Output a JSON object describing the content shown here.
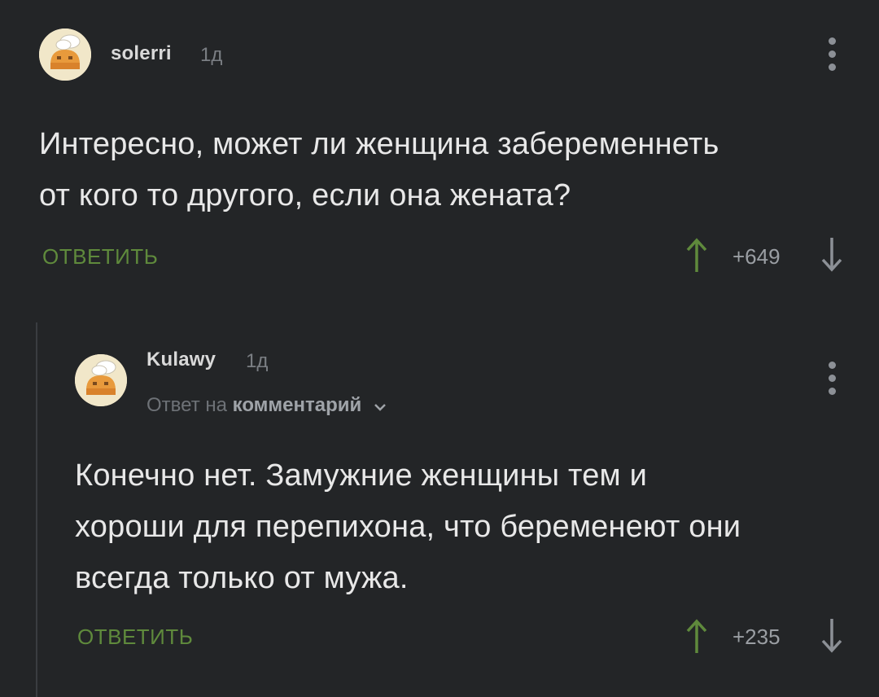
{
  "comments": [
    {
      "author": "solerri",
      "time": "1д",
      "text_lines": [
        "Интересно, может ли женщина забеременнеть",
        "от кого то другого, если она жената?"
      ],
      "reply_label": "ОТВЕТИТЬ",
      "score": "+649",
      "avatar_icon": "avatar-cook-icon"
    },
    {
      "author": "Kulawy",
      "time": "1д",
      "reply_to_prefix": "Ответ на",
      "reply_to_link": "комментарий",
      "text_lines": [
        "Конечно нет. Замужние женщины тем и",
        "хороши для перепихона, что беременеют они",
        "всегда только от мужа."
      ],
      "reply_label": "ОТВЕТИТЬ",
      "score": "+235",
      "avatar_icon": "avatar-cook-icon"
    }
  ],
  "colors": {
    "background": "#232527",
    "accent_green": "#5f8a3c",
    "text": "#e8e8e8",
    "muted": "#7b7f84"
  },
  "icons": {
    "menu": "kebab-menu-icon",
    "upvote": "arrow-up-icon",
    "downvote": "arrow-down-icon",
    "expand": "chevron-down-icon"
  }
}
